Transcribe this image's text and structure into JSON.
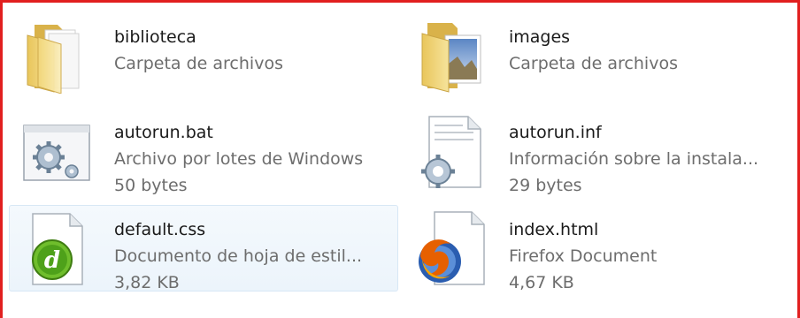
{
  "items": [
    {
      "name": "biblioteca",
      "type": "Carpeta de archivos",
      "size": "",
      "icon": "folder-icon"
    },
    {
      "name": "images",
      "type": "Carpeta de archivos",
      "size": "",
      "icon": "image-folder-icon"
    },
    {
      "name": "autorun.bat",
      "type": "Archivo por lotes de Windows",
      "size": "50 bytes",
      "icon": "batch-file-icon"
    },
    {
      "name": "autorun.inf",
      "type": "Información sobre la instala...",
      "size": "29 bytes",
      "icon": "setup-info-file-icon"
    },
    {
      "name": "default.css",
      "type": "Documento de hoja de estil...",
      "size": "3,82 KB",
      "icon": "css-document-icon",
      "selected": true
    },
    {
      "name": "index.html",
      "type": "Firefox Document",
      "size": "4,67 KB",
      "icon": "firefox-document-icon"
    }
  ],
  "colors": {
    "frame": "#e11f1f",
    "selection_bg": "#eef5fb",
    "name_text": "#1a1a1a",
    "meta_text": "#6d6d6d"
  }
}
